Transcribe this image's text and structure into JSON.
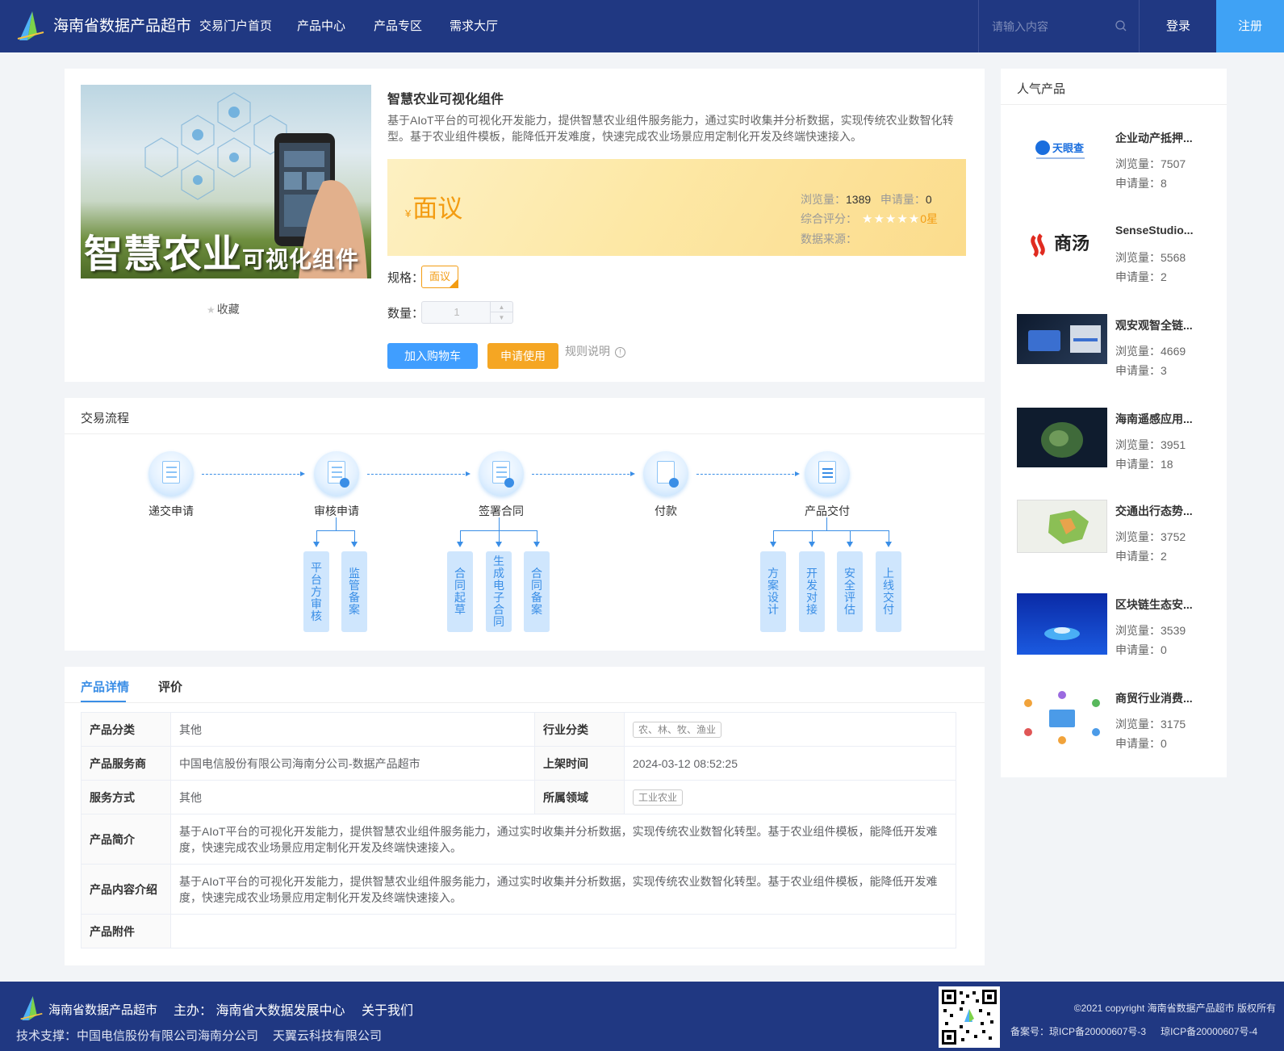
{
  "header": {
    "site_title": "海南省数据产品超市",
    "nav": [
      "交易门户首页",
      "产品中心",
      "产品专区",
      "需求大厅"
    ],
    "search_placeholder": "请输入内容",
    "login": "登录",
    "register": "注册"
  },
  "product": {
    "image_caption_main": "智慧农业",
    "image_caption_sub": "可视化组件",
    "favorite": "收藏",
    "title": "智慧农业可视化组件",
    "description": "基于AIoT平台的可视化开发能力，提供智慧农业组件服务能力，通过实时收集并分析数据，实现传统农业数智化转型。基于农业组件模板，能降低开发难度，快速完成农业场景应用定制化开发及终端快速接入。",
    "currency": "¥",
    "price": "面议",
    "views_label": "浏览量：",
    "views": "1389",
    "applies_label": "申请量：",
    "applies": "0",
    "rating_label": "综合评分：",
    "rating_stars": 0,
    "rating_text": "0星",
    "source_label": "数据来源：",
    "spec_label": "规格：",
    "spec_value": "面议",
    "qty_label": "数量：",
    "qty_value": "1",
    "add_cart": "加入购物车",
    "apply": "申请使用",
    "rules": "规则说明"
  },
  "process": {
    "title": "交易流程",
    "steps": [
      "递交申请",
      "审核申请",
      "签署合同",
      "付款",
      "产品交付"
    ],
    "substeps": {
      "review": [
        "平台方审核",
        "监管备案"
      ],
      "contract": [
        "合同起草",
        "生成电子合同",
        "合同备案"
      ],
      "delivery": [
        "方案设计",
        "开发对接",
        "安全评估",
        "上线交付"
      ]
    }
  },
  "details": {
    "tabs": [
      "产品详情",
      "评价"
    ],
    "rows": {
      "category_k": "产品分类",
      "category_v": "其他",
      "industry_k": "行业分类",
      "industry_v": "农、林、牧、渔业",
      "provider_k": "产品服务商",
      "provider_v": "中国电信股份有限公司海南分公司-数据产品超市",
      "listed_k": "上架时间",
      "listed_v": "2024-03-12 08:52:25",
      "service_k": "服务方式",
      "service_v": "其他",
      "domain_k": "所属领域",
      "domain_v": "工业农业",
      "intro_k": "产品简介",
      "intro_v": "基于AIoT平台的可视化开发能力，提供智慧农业组件服务能力，通过实时收集并分析数据，实现传统农业数智化转型。基于农业组件模板，能降低开发难度，快速完成农业场景应用定制化开发及终端快速接入。",
      "content_k": "产品内容介绍",
      "content_v": "基于AIoT平台的可视化开发能力，提供智慧农业组件服务能力，通过实时收集并分析数据，实现传统农业数智化转型。基于农业组件模板，能降低开发难度，快速完成农业场景应用定制化开发及终端快速接入。",
      "attach_k": "产品附件",
      "attach_v": ""
    }
  },
  "sidebar": {
    "title": "人气产品",
    "views_label": "浏览量：",
    "applies_label": "申请量：",
    "items": [
      {
        "name": "企业动产抵押...",
        "views": "7507",
        "applies": "8",
        "thumb_text": "天眼查"
      },
      {
        "name": "SenseStudio...",
        "views": "5568",
        "applies": "2",
        "thumb_text": "商汤"
      },
      {
        "name": "观安观智全链...",
        "views": "4669",
        "applies": "3",
        "thumb_text": ""
      },
      {
        "name": "海南遥感应用...",
        "views": "3951",
        "applies": "18",
        "thumb_text": ""
      },
      {
        "name": "交通出行态势...",
        "views": "3752",
        "applies": "2",
        "thumb_text": ""
      },
      {
        "name": "区块链生态安...",
        "views": "3539",
        "applies": "0",
        "thumb_text": ""
      },
      {
        "name": "商贸行业消费...",
        "views": "3175",
        "applies": "0",
        "thumb_text": ""
      }
    ]
  },
  "footer": {
    "site": "海南省数据产品超市",
    "host": "主办： 海南省大数据发展中心",
    "about": "关于我们",
    "tech": [
      "技术支撑：中国电信股份有限公司海南分公司",
      "天翼云科技有限公司"
    ],
    "copyright": "©2021 copyright 海南省数据产品超市 版权所有",
    "icp": [
      "备案号：琼ICP备20000607号-3",
      "琼ICP备20000607号-4"
    ]
  },
  "colors": {
    "header_bg": "#203882",
    "accent_blue": "#3a8ee6",
    "register_bg": "#3fa2f5",
    "orange": "#f39c12"
  }
}
